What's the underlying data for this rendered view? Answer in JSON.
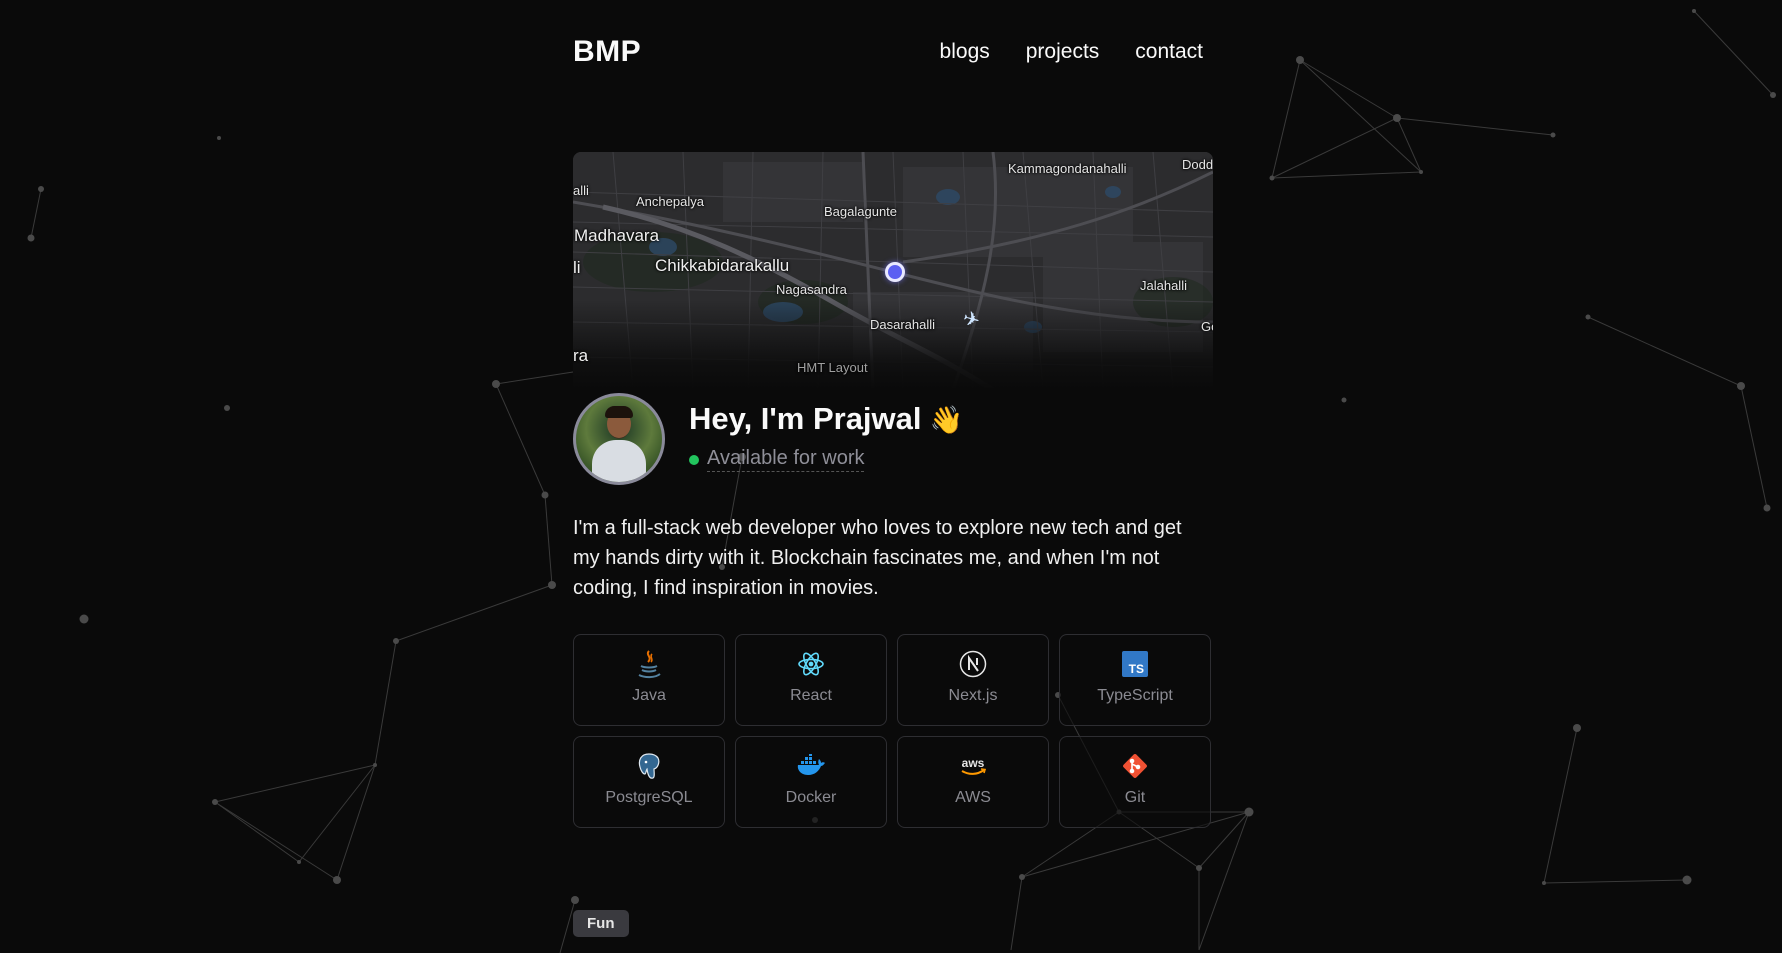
{
  "nav": {
    "logo": "BMP",
    "links": [
      "blogs",
      "projects",
      "contact"
    ]
  },
  "map": {
    "places": [
      "Kammagondanahalli",
      "Dodd",
      "alli",
      "Anchepalya",
      "Bagalagunte",
      "Madhavara",
      "li",
      "Chikkabidarakallu",
      "Nagasandra",
      "Jalahalli",
      "Dasarahalli",
      "Go",
      "ra",
      "HMT Layout"
    ],
    "current_location_icon": "location-dot-icon",
    "plane_icon": "airplane-icon"
  },
  "profile": {
    "greeting": "Hey, I'm Prajwal",
    "wave_emoji": "👋",
    "status": "Available for work",
    "status_color": "#22c55e"
  },
  "bio": "I'm a full-stack web developer who loves to explore new tech and get my hands dirty with it. Blockchain fascinates me, and when I'm not coding, I find inspiration in movies.",
  "skills": [
    {
      "label": "Java",
      "icon": "java-icon"
    },
    {
      "label": "React",
      "icon": "react-icon"
    },
    {
      "label": "Next.js",
      "icon": "nextjs-icon"
    },
    {
      "label": "TypeScript",
      "icon": "typescript-icon"
    },
    {
      "label": "PostgreSQL",
      "icon": "postgresql-icon"
    },
    {
      "label": "Docker",
      "icon": "docker-icon"
    },
    {
      "label": "AWS",
      "icon": "aws-icon"
    },
    {
      "label": "Git",
      "icon": "git-icon"
    }
  ],
  "section_badge": "Fun",
  "colors": {
    "background": "#0a0a0a",
    "text": "#fafafa",
    "muted": "#8b8b92",
    "card_border": "#2e2e32",
    "accent_location": "#5b5ff2"
  }
}
